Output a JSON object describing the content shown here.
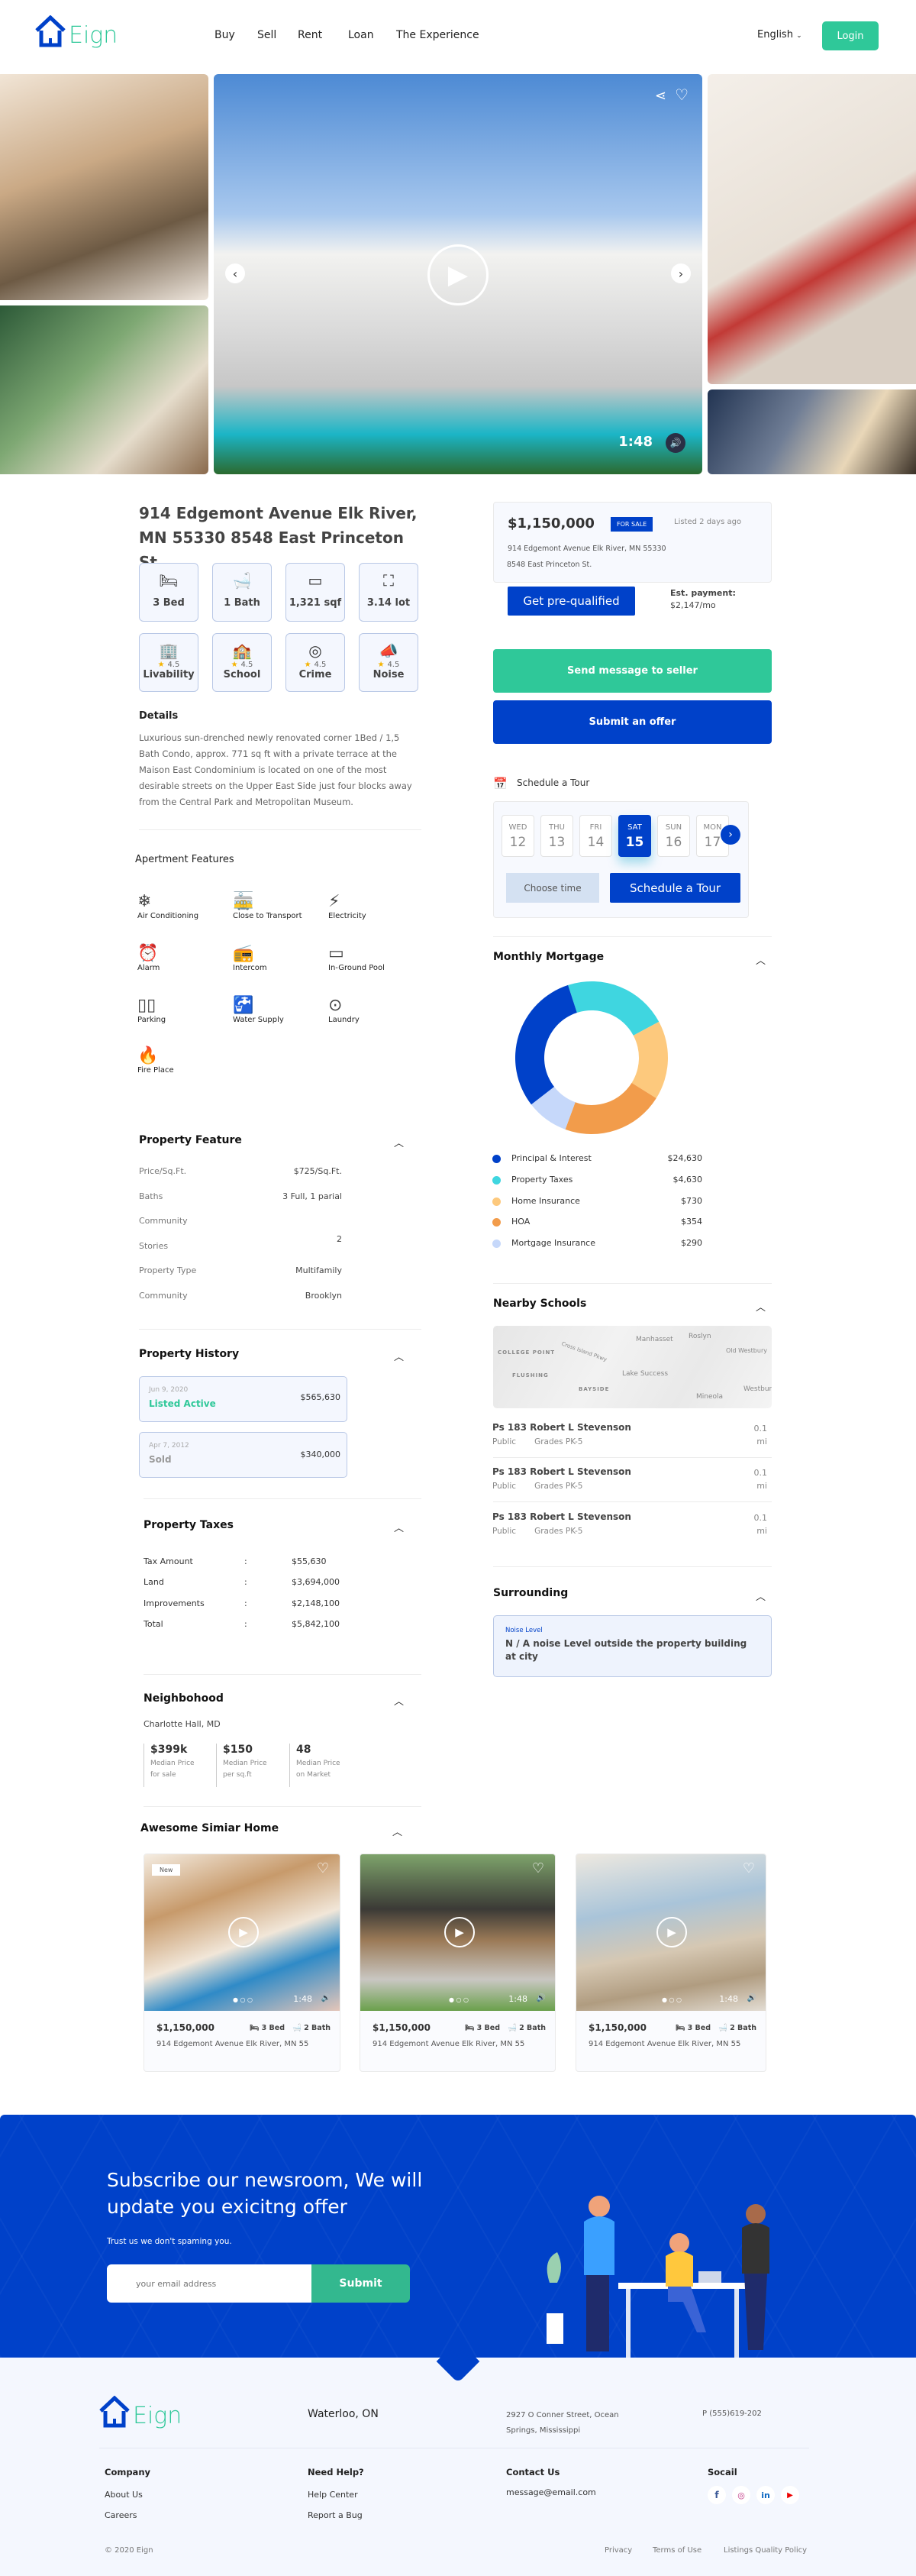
{
  "brand": {
    "name": "Eign",
    "primary": "#0041c9",
    "accent": "#2fc899"
  },
  "nav": {
    "items": [
      "Buy",
      "Sell",
      "Rent",
      "Loan",
      "The Experience"
    ],
    "language": "English",
    "login": "Login"
  },
  "gallery": {
    "duration": "1:48",
    "icons": [
      "share-icon",
      "heart-icon",
      "volume-icon",
      "play-icon",
      "chevron-left-icon",
      "chevron-right-icon"
    ]
  },
  "listing": {
    "title": "914 Edgemont Avenue Elk River, MN 55330 8548 East Princeton St.",
    "facts": [
      {
        "icon": "bed-icon",
        "label": "3 Bed"
      },
      {
        "icon": "bath-icon",
        "label": "1 Bath"
      },
      {
        "icon": "area-icon",
        "label": "1,321 sqf"
      },
      {
        "icon": "lot-icon",
        "label": "3.14 lot"
      }
    ],
    "ratings": [
      {
        "icon": "building-icon",
        "score": "4.5",
        "label": "Livability"
      },
      {
        "icon": "school-icon",
        "score": "4.5",
        "label": "School"
      },
      {
        "icon": "handcuffs-icon",
        "score": "4.5",
        "label": "Crime"
      },
      {
        "icon": "megaphone-icon",
        "score": "4.5",
        "label": "Noise"
      }
    ],
    "details_heading": "Details",
    "details": "Luxurious sun-drenched newly renovated corner 1Bed / 1,5 Bath Condo, approx. 771 sq ft with a private terrace at the Maison East Condominium is located on one of the most desirable streets on the Upper East Side just four blocks away from the Central Park and Metropolitan Museum."
  },
  "apartment_features": {
    "heading": "Apertment Features",
    "items": [
      {
        "icon": "air-conditioner-icon",
        "label": "Air Conditioning"
      },
      {
        "icon": "tram-icon",
        "label": "Close to Transport"
      },
      {
        "icon": "electricity-icon",
        "label": "Electricity"
      },
      {
        "icon": "alarm-icon",
        "label": "Alarm"
      },
      {
        "icon": "intercom-icon",
        "label": "Intercom"
      },
      {
        "icon": "pool-icon",
        "label": "In-Ground Pool"
      },
      {
        "icon": "parking-icon",
        "label": "Parking"
      },
      {
        "icon": "faucet-icon",
        "label": "Water Supply"
      },
      {
        "icon": "washing-machine-icon",
        "label": "Laundry"
      },
      {
        "icon": "fireplace-icon",
        "label": "Fire Place"
      }
    ]
  },
  "property_feature": {
    "heading": "Property Feature",
    "rows": [
      {
        "label": "Price/Sq.Ft.",
        "value": "$725/Sq.Ft."
      },
      {
        "label": "Baths",
        "value": "3 Full, 1 parial"
      },
      {
        "label": "Community",
        "value": ""
      },
      {
        "label": "Stories",
        "value": "2"
      },
      {
        "label": "Property Type",
        "value": "Multifamily"
      },
      {
        "label": "Community",
        "value": "Brooklyn"
      }
    ]
  },
  "property_history": {
    "heading": "Property History",
    "items": [
      {
        "date": "Jun 9, 2020",
        "status": "Listed Active",
        "price": "$565,630"
      },
      {
        "date": "Apr 7, 2012",
        "status": "Sold",
        "price": "$340,000"
      }
    ]
  },
  "property_taxes": {
    "heading": "Property Taxes",
    "rows": [
      {
        "label": "Tax Amount",
        "value": "$55,630"
      },
      {
        "label": "Land",
        "value": "$3,694,000"
      },
      {
        "label": "Improvements",
        "value": "$2,148,100"
      },
      {
        "label": "Total",
        "value": "$5,842,100"
      }
    ],
    "separator": ":"
  },
  "neighborhood": {
    "heading": "Neighbohood",
    "location": "Charlotte Hall, MD",
    "stats": [
      {
        "value": "$399k",
        "label1": "Median Price",
        "label2": "for sale"
      },
      {
        "value": "$150",
        "label1": "Median Price",
        "label2": "per sq.ft"
      },
      {
        "value": "48",
        "label1": "Median Price",
        "label2": "on Market"
      }
    ]
  },
  "similar": {
    "heading": "Awesome Simiar Home",
    "badge": "New",
    "cards": [
      {
        "price": "$1,150,000",
        "beds": "3 Bed",
        "baths": "2 Bath",
        "address": "914 Edgemont Avenue  Elk River, MN 55",
        "duration": "1:48"
      },
      {
        "price": "$1,150,000",
        "beds": "3 Bed",
        "baths": "2 Bath",
        "address": "914 Edgemont Avenue  Elk River, MN 55",
        "duration": "1:48"
      },
      {
        "price": "$1,150,000",
        "beds": "3 Bed",
        "baths": "2 Bath",
        "address": "914 Edgemont Avenue  Elk River, MN 55",
        "duration": "1:48"
      }
    ]
  },
  "price_card": {
    "price": "$1,150,000",
    "badge": "FOR SALE",
    "listed": "Listed 2 days ago",
    "address1": "914 Edgemont Avenue Elk River, MN 55330",
    "address2": "8548 East Princeton St.",
    "prequal": "Get pre-qualified",
    "est_label": "Est. payment:",
    "est_value": "$2,147/mo"
  },
  "actions": {
    "message": "Send message to seller",
    "offer": "Submit an offer"
  },
  "tour": {
    "heading": "Schedule a Tour",
    "days": [
      {
        "day": "WED",
        "date": "12"
      },
      {
        "day": "THU",
        "date": "13"
      },
      {
        "day": "FRI",
        "date": "14"
      },
      {
        "day": "SAT",
        "date": "15",
        "selected": true
      },
      {
        "day": "SUN",
        "date": "16"
      },
      {
        "day": "MON",
        "date": "17"
      }
    ],
    "choose_time": "Choose time",
    "schedule": "Schedule a Tour"
  },
  "chart_data": {
    "type": "pie",
    "donut": true,
    "title": "Monthly Mortgage",
    "categories": [
      "Principal & Interest",
      "Property Taxes",
      "Home Insurance",
      "HOA",
      "Mortgage Insurance"
    ],
    "values": [
      "$24,630",
      "$4,630",
      "$730",
      "$354",
      "$290"
    ],
    "arc_percent": [
      30.5,
      22.2,
      16.7,
      21.7,
      8.9
    ],
    "colors": [
      "#0041c9",
      "#3fd6e0",
      "#fdc97d",
      "#f29c4b",
      "#c6d8fa"
    ],
    "legend": "bottom"
  },
  "schools": {
    "heading": "Nearby Schools",
    "map_labels": [
      "Manhasset",
      "Roslyn",
      "Old Westbury",
      "COLLEGE POINT",
      "Cross Island Pkwy",
      "Lake Success",
      "FLUSHING",
      "BAYSIDE",
      "Westbur",
      "Mineola"
    ],
    "items": [
      {
        "name": "Ps 183 Robert L Stevenson",
        "type": "Public",
        "grades": "Grades PK-5",
        "dist": "0.1 mi"
      },
      {
        "name": "Ps 183 Robert L Stevenson",
        "type": "Public",
        "grades": "Grades PK-5",
        "dist": "0.1 mi"
      },
      {
        "name": "Ps 183 Robert L Stevenson",
        "type": "Public",
        "grades": "Grades PK-5",
        "dist": "0.1 mi"
      }
    ]
  },
  "surrounding": {
    "heading": "Surrounding",
    "label": "Noise Level",
    "text": "N / A noise Level outside the property building at city"
  },
  "newsletter": {
    "heading": "Subscribe our newsroom, We will update you exicitng offer",
    "sub": "Trust us we don't spaming you.",
    "placeholder": "your email address",
    "submit": "Submit"
  },
  "footer": {
    "city": "Waterloo, ON",
    "address": "2927  O Conner Street, Ocean Springs, Mississippi",
    "phone": "P (555)619-202",
    "cols": [
      {
        "heading": "Company",
        "links": [
          "About Us",
          "Careers"
        ]
      },
      {
        "heading": "Need Help?",
        "links": [
          "Help Center",
          "Report a Bug"
        ]
      },
      {
        "heading": "Contact Us",
        "links": [
          "message@email.com"
        ]
      },
      {
        "heading": "Socail",
        "links": []
      }
    ],
    "social": [
      "facebook-icon",
      "instagram-icon",
      "linkedin-icon",
      "youtube-icon"
    ],
    "copyright": "© 2020 Eign",
    "legal": [
      "Privacy",
      "Terms of Use",
      "Listings Quality Policy"
    ]
  }
}
